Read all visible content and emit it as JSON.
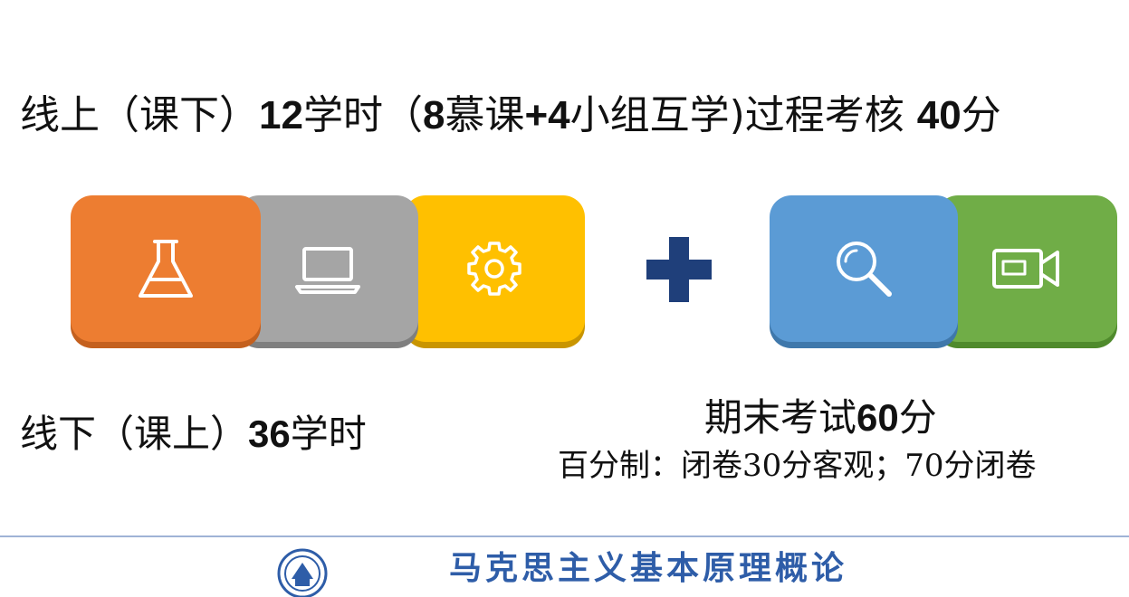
{
  "headline": {
    "part1": "线上（课下）",
    "hours": "12",
    "part2": "学时（",
    "mooc_num": "8",
    "part3": "慕课",
    "plus_num": "+4",
    "part4": "小组互学",
    "part5": ")过程考核 ",
    "score": "40",
    "unit": "分"
  },
  "offline": {
    "part1": "线下（课上）",
    "hours": "36",
    "part2": "学时"
  },
  "final_exam": {
    "title_text": "期末考试",
    "score": "60",
    "unit": "分",
    "detail": "百分制：闭卷30分客观；70分闭卷"
  },
  "tiles": [
    {
      "icon": "flask-icon",
      "color": "#ed7d31",
      "shade": "#c4601e"
    },
    {
      "icon": "laptop-icon",
      "color": "#a5a5a5",
      "shade": "#7f7f7f"
    },
    {
      "icon": "gear-icon",
      "color": "#ffc000",
      "shade": "#c99500"
    },
    {
      "icon": "magnifier-icon",
      "color": "#5b9bd5",
      "shade": "#3f78ab"
    },
    {
      "icon": "video-camera-icon",
      "color": "#70ad47",
      "shade": "#4f8a2c"
    }
  ],
  "plus_color": "#1f3f7a",
  "footer": {
    "title": "马克思主义基本原理概论",
    "title_color": "#2e5da8"
  }
}
